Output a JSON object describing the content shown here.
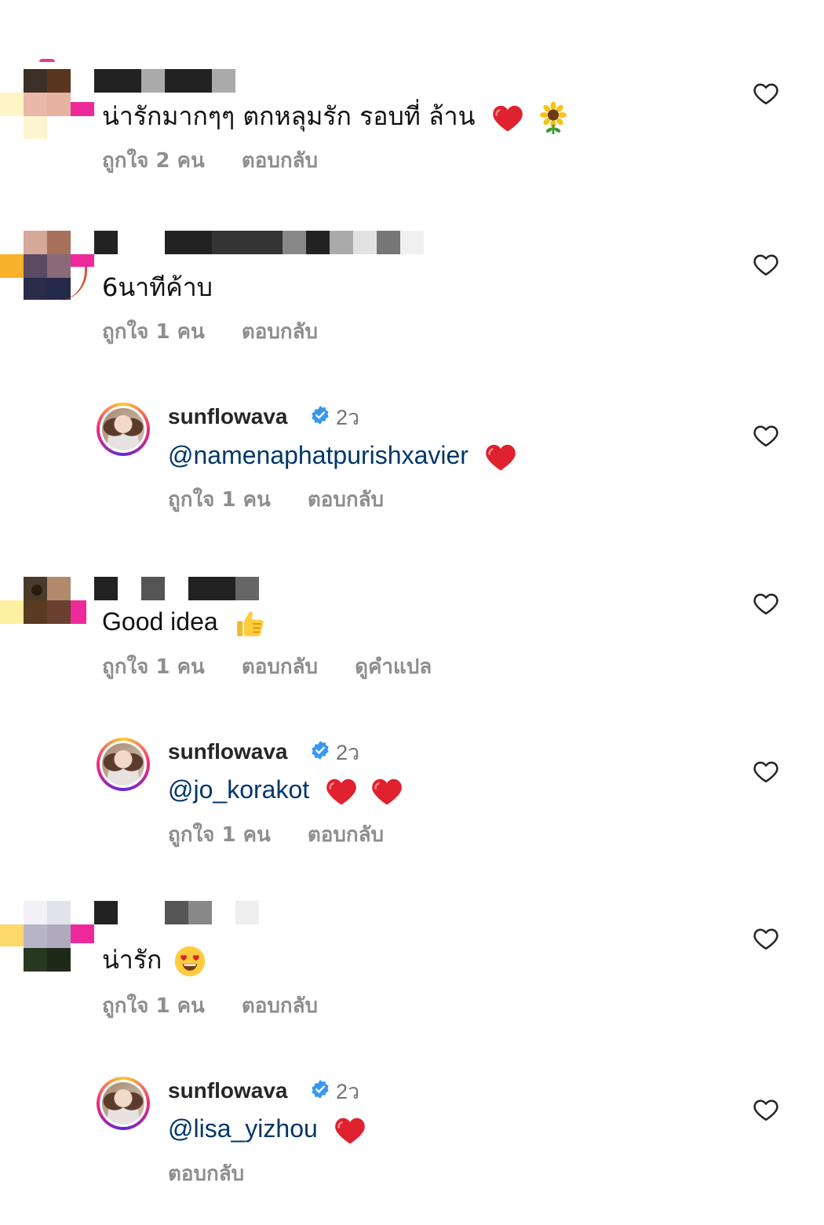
{
  "comments": [
    {
      "text": "น่ารักมากๆๆ ตกหลุมรัก รอบที่ ล้าน",
      "likes": "ถูกใจ 2 คน",
      "reply": "ตอบกลับ",
      "emojis": [
        "red-heart",
        "sunflower"
      ]
    },
    {
      "text": "6นาทีค้าบ",
      "likes": "ถูกใจ 1 คน",
      "reply": "ตอบกลับ"
    },
    {
      "username": "sunflowava",
      "time": "2ว",
      "mention": "@namenaphatpurishxavier",
      "likes": "ถูกใจ 1 คน",
      "reply": "ตอบกลับ",
      "emojis": [
        "red-heart"
      ]
    },
    {
      "text": "Good idea",
      "likes": "ถูกใจ 1 คน",
      "reply": "ตอบกลับ",
      "translate": "ดูคำแปล",
      "emojis": [
        "thumbs-up"
      ]
    },
    {
      "username": "sunflowava",
      "time": "2ว",
      "mention": "@jo_korakot",
      "likes": "ถูกใจ 1 คน",
      "reply": "ตอบกลับ",
      "emojis": [
        "red-heart",
        "red-heart"
      ]
    },
    {
      "text": "น่ารัก",
      "likes": "ถูกใจ 1 คน",
      "reply": "ตอบกลับ",
      "emojis": [
        "heart-eyes-face"
      ]
    },
    {
      "username": "sunflowava",
      "time": "2ว",
      "mention": "@lisa_yizhou",
      "reply": "ตอบกลับ",
      "emojis": [
        "red-heart"
      ]
    }
  ],
  "colors": {
    "mention": "#00376b",
    "meta": "#8e8e8e",
    "verified": "#3897f0",
    "heart": "#e0212f"
  }
}
